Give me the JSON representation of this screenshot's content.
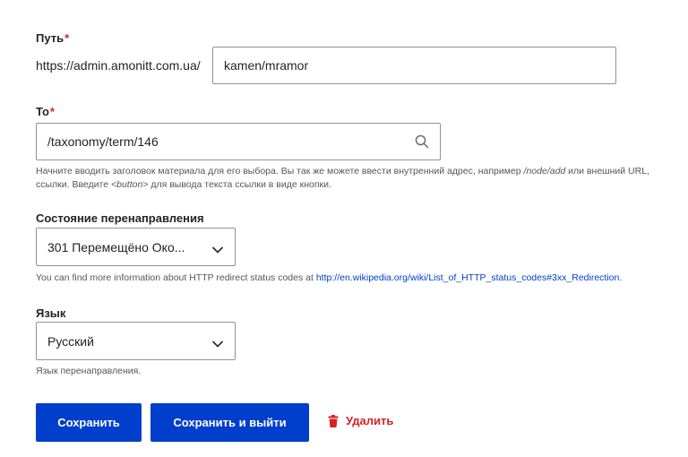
{
  "path": {
    "label": "Путь",
    "required_mark": "*",
    "prefix": "https://admin.amonitt.com.ua/",
    "value": "kamen/mramor"
  },
  "to": {
    "label": "To",
    "required_mark": "*",
    "value": "/taxonomy/term/146",
    "description_part1": "Начните вводить заголовок материала для его выбора. Вы так же можете ввести внутренний адрес, например ",
    "description_example1": "/node/add",
    "description_part2": " или внешний URL,",
    "description_part3": "ссылки. Введите ",
    "description_example2": "<button>",
    "description_part4": " для вывода текста ссылки в виде кнопки."
  },
  "redirect_status": {
    "label": "Состояние перенаправления",
    "selected": "301 Перемещёно Око...",
    "description_text": "You can find more information about HTTP redirect status codes at ",
    "description_link": "http://en.wikipedia.org/wiki/List_of_HTTP_status_codes#3xx_Redirection",
    "description_end": "."
  },
  "language": {
    "label": "Язык",
    "selected": "Русский",
    "description": "Язык перенаправления."
  },
  "actions": {
    "save_label": "Сохранить",
    "save_exit_label": "Сохранить и выйти",
    "delete_label": "Удалить",
    "delete_icon": "trash-icon"
  },
  "colors": {
    "primary": "#003ecc",
    "danger": "#d72222",
    "required": "#dc2323",
    "link": "#003ecc"
  }
}
